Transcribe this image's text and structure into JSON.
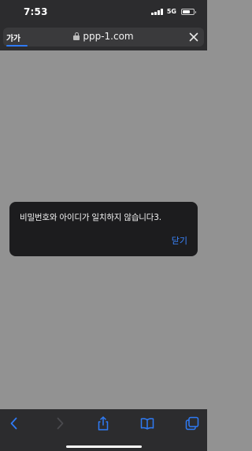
{
  "status_bar": {
    "time": "7:53",
    "network": "5G",
    "icons": [
      "signal-icon",
      "battery-icon"
    ]
  },
  "address_bar": {
    "text_size_label": "가가",
    "url": "ppp-1.com",
    "icons": [
      "lock-icon",
      "close-icon"
    ],
    "accent_color": "#2f7bf5"
  },
  "alert": {
    "message": "비밀번호와 아이디가 일치하지 않습니다3.",
    "close_label": "닫기",
    "button_color": "#3a85ff"
  },
  "toolbar": {
    "icons": [
      "back-icon",
      "forward-icon",
      "share-icon",
      "bookmarks-icon",
      "tabs-icon"
    ],
    "active_color": "#2f7bf5",
    "disabled_color": "#4a4a4e"
  }
}
